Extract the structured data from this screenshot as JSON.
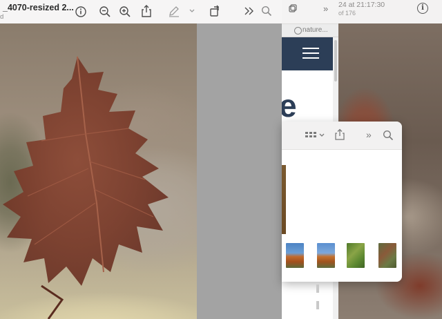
{
  "preview": {
    "file_title": "_4070-resized 2...",
    "file_subtitle": "d",
    "icons": [
      "info-icon",
      "zoom-out-icon",
      "zoom-in-icon",
      "share-icon",
      "markup-pen-icon",
      "chevron-down-icon",
      "rotate-icon",
      "more-chevrons-icon",
      "search-icon"
    ]
  },
  "browser": {
    "address_text": "nature...",
    "heading_fragment": "e",
    "more_label": "»"
  },
  "background_window": {
    "date_text": "24 at 21:17:30",
    "count_text": "of 176"
  },
  "photos_panel": {
    "more_label": "»"
  },
  "colors": {
    "site_header": "#2c3e57",
    "toolbar_bg": "#f6f5f5",
    "gray_gap": "#a3a3a3"
  }
}
